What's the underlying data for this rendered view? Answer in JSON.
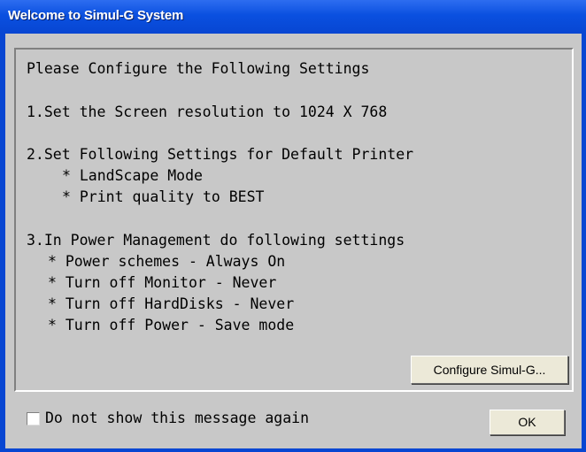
{
  "window": {
    "title": "Welcome to Simul-G System"
  },
  "message": {
    "heading": "Please Configure the Following Settings",
    "step1": "1.Set the Screen resolution to 1024 X 768",
    "step2": "2.Set Following Settings for Default Printer",
    "step2_items": [
      "* LandScape Mode",
      "* Print quality to BEST"
    ],
    "step3": "3.In Power Management do following settings",
    "step3_items": [
      "* Power schemes - Always On",
      "* Turn off Monitor - Never",
      "* Turn off HardDisks - Never",
      "* Turn off Power - Save mode"
    ]
  },
  "buttons": {
    "configure_label": "Configure Simul-G...",
    "ok_label": "OK"
  },
  "footer": {
    "checkbox_label": "Do not show this message again",
    "checkbox_checked": false
  }
}
